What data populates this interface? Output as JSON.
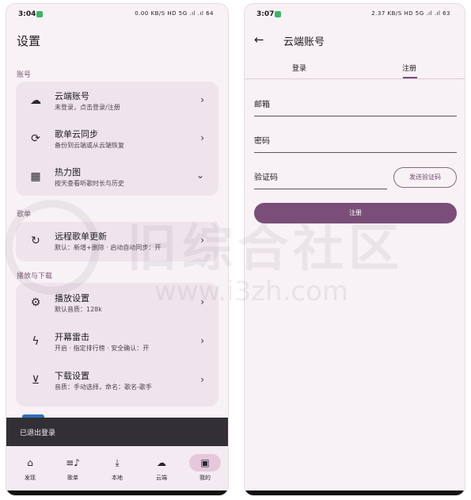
{
  "left": {
    "status": {
      "time": "3:04",
      "sys": "0.00 KB/S HD 5G .ıl .ıl 64"
    },
    "title": "设置",
    "sections": {
      "account": "账号",
      "playlist": "歌单",
      "playback": "播放与下载"
    },
    "account_items": [
      {
        "title": "云端账号",
        "subtitle": "未登录，点击登录/注册",
        "icon": "cloud-icon"
      },
      {
        "title": "歌单云同步",
        "subtitle": "备份到云端或从云端恢复",
        "icon": "sync-icon"
      },
      {
        "title": "热力图",
        "subtitle": "按天查看听歌时长与历史",
        "icon": "grid-icon"
      }
    ],
    "playlist_items": [
      {
        "title": "远程歌单更新",
        "subtitle": "默认：新增+删除 · 启动自动同步：开",
        "icon": "refresh-icon"
      }
    ],
    "playback_items": [
      {
        "title": "播放设置",
        "subtitle": "默认音质：128k",
        "icon": "gear-icon"
      },
      {
        "title": "开幕雷击",
        "subtitle": "开启 · 指定排行榜 · 安全确认：开",
        "icon": "bolt-icon"
      },
      {
        "title": "下载设置",
        "subtitle": "音质：手动选择，命名：歌名-歌手",
        "icon": "download-icon"
      }
    ],
    "snackbar": "已退出登录",
    "nav": [
      {
        "label": "发现",
        "icon": "home-icon"
      },
      {
        "label": "歌单",
        "icon": "playlist-icon"
      },
      {
        "label": "本地",
        "icon": "download-icon"
      },
      {
        "label": "云端",
        "icon": "cloud-icon"
      },
      {
        "label": "我的",
        "icon": "library-icon",
        "active": true
      }
    ]
  },
  "right": {
    "status": {
      "time": "3:07",
      "sys": "2.37 KB/S HD 5G .ıl .ıl 63"
    },
    "title": "云端账号",
    "tabs": [
      {
        "label": "登录"
      },
      {
        "label": "注册",
        "active": true
      }
    ],
    "fields": {
      "email": "邮箱",
      "password": "密码",
      "code": "验证码"
    },
    "send_code_label": "发送验证码",
    "register_label": "注册"
  },
  "watermark": {
    "big": "旧综合社区",
    "url": "www.i3zh.com"
  },
  "colors": {
    "accent": "#7a4e78",
    "background": "#f8f1f6",
    "card": "#efe3ec",
    "snackbar": "#322f35"
  }
}
